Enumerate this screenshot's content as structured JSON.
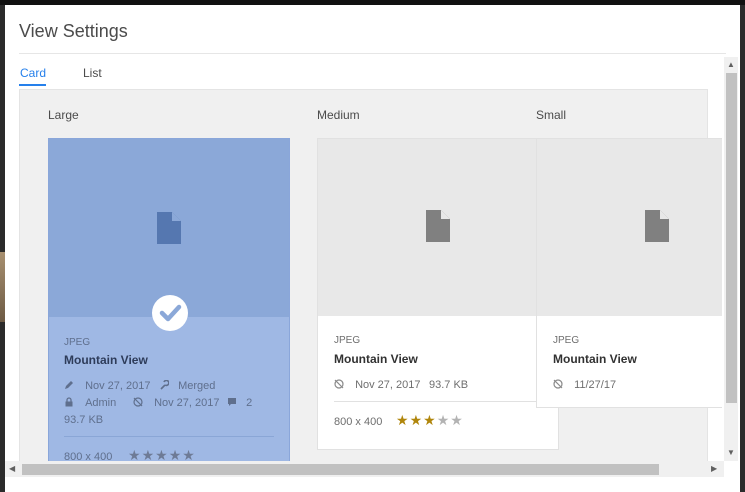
{
  "dialog": {
    "title": "View Settings"
  },
  "tabs": [
    {
      "label": "Card",
      "active": true
    },
    {
      "label": "List",
      "active": false
    }
  ],
  "sizes": {
    "large": {
      "label": "Large",
      "selected": true,
      "type": "JPEG",
      "name": "Mountain View",
      "modified_date": "Nov 27, 2017",
      "status": "Merged",
      "author": "Admin",
      "published_date": "Nov 27, 2017",
      "comments": "2",
      "file_size": "93.7 KB",
      "dimensions": "800 x 400",
      "rating": 0,
      "rating_max": 5
    },
    "medium": {
      "label": "Medium",
      "selected": false,
      "type": "JPEG",
      "name": "Mountain View",
      "date": "Nov 27, 2017",
      "file_size": "93.7 KB",
      "dimensions": "800 x 400",
      "rating": 3,
      "rating_max": 5
    },
    "small": {
      "label": "Small",
      "selected": false,
      "type": "JPEG",
      "name": "Mountain View",
      "date": "11/27/17"
    }
  },
  "colors": {
    "accent": "#2680eb",
    "selected_card": "#9fb8e4",
    "star_filled": "#b0860c",
    "star_empty": "#b3b3b3"
  },
  "icons": {
    "file": "file-icon",
    "edit": "pencil-icon",
    "status": "wrench-icon",
    "author": "lock-icon",
    "published": "globe-icon",
    "comments": "comment-icon",
    "selected": "checkmark-icon"
  }
}
